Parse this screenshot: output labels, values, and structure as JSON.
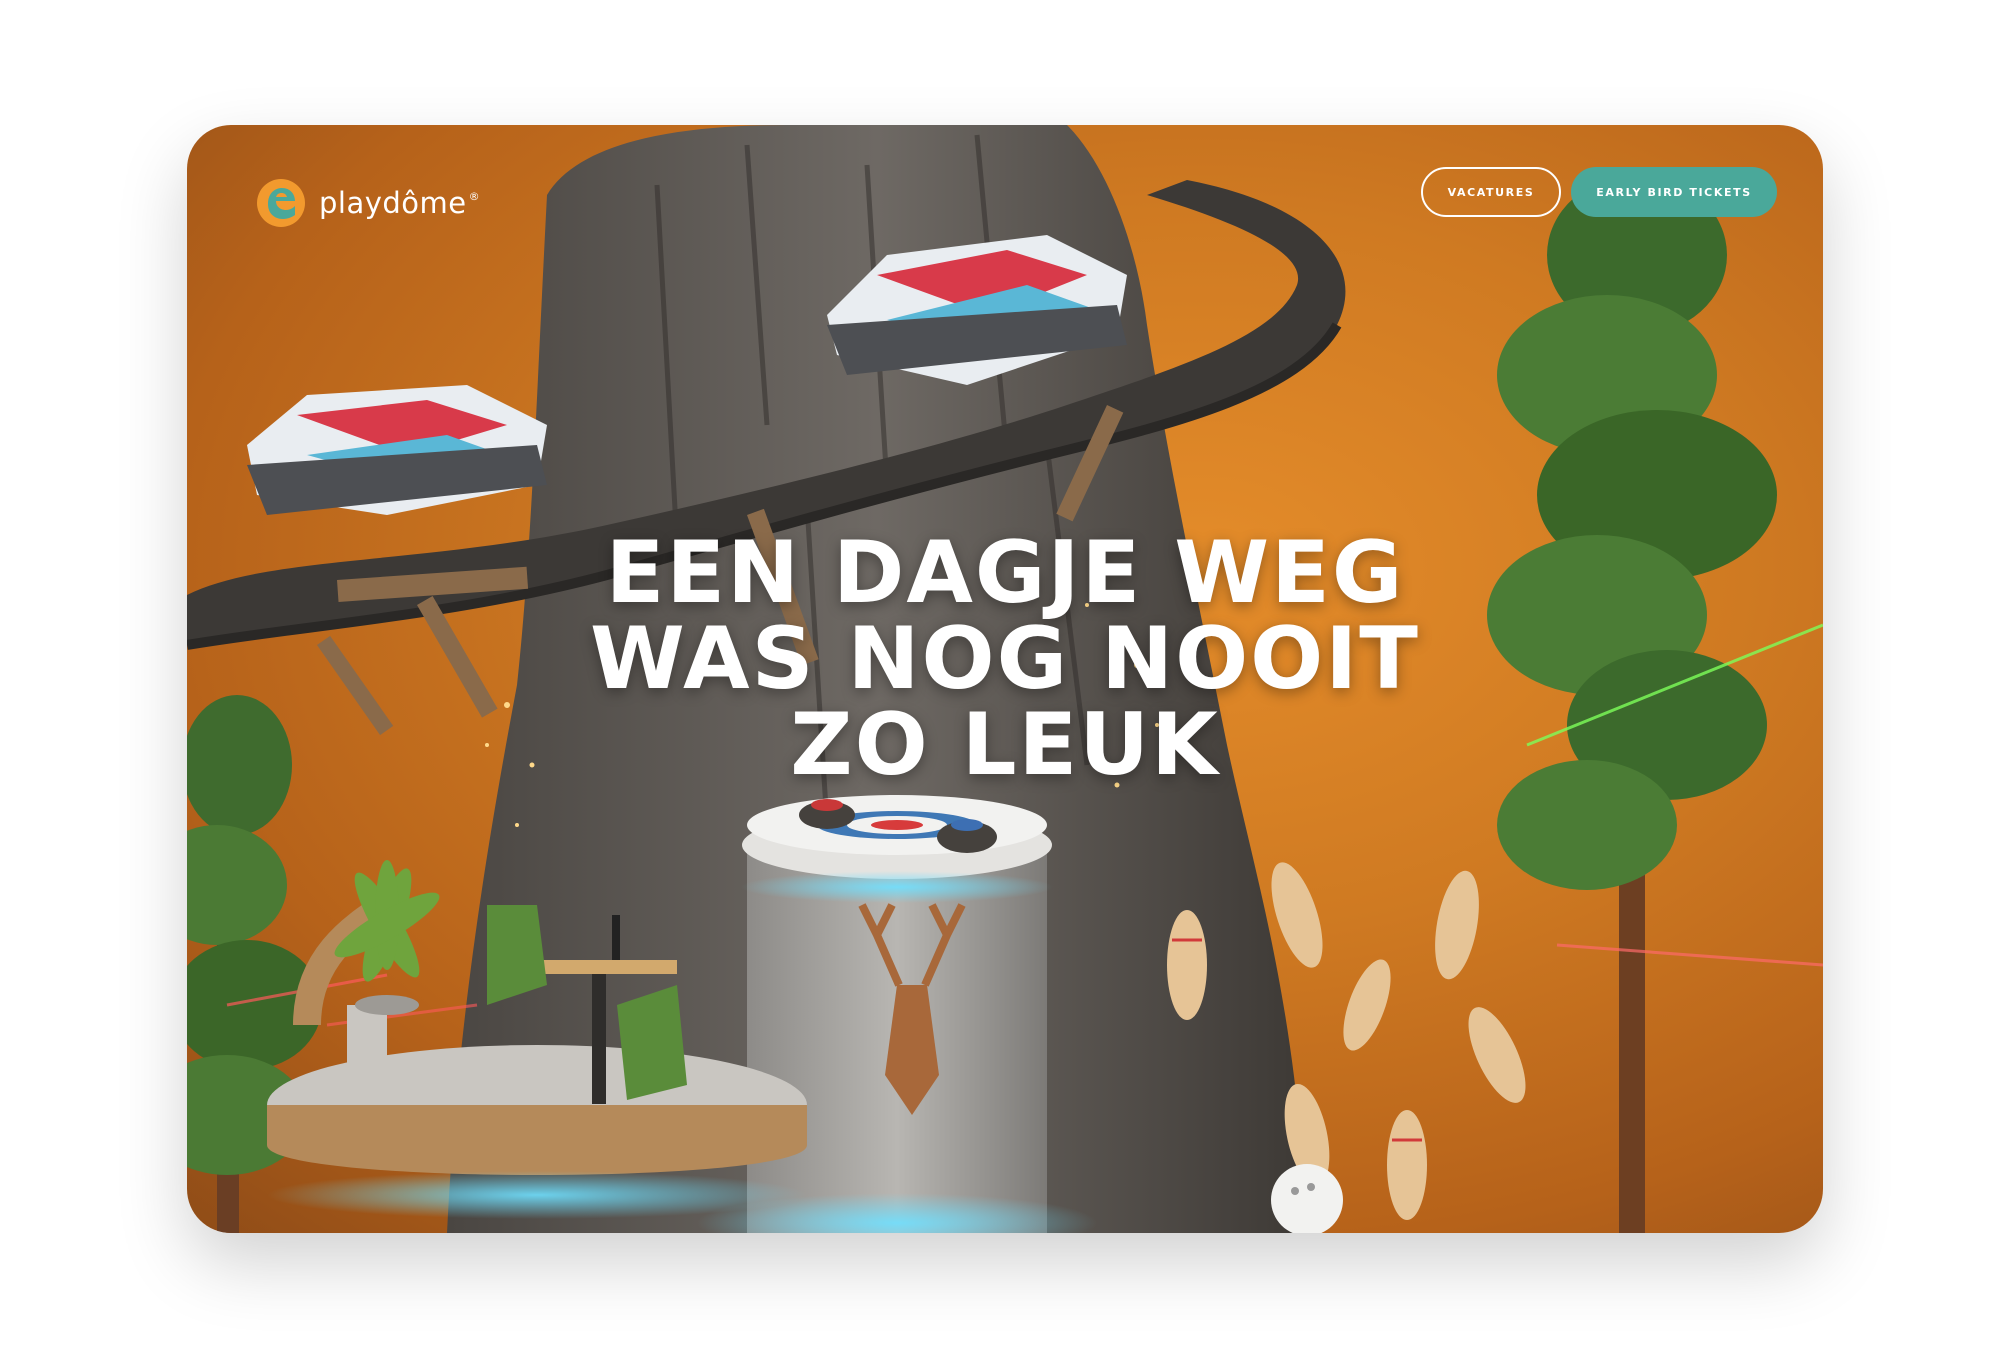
{
  "brand": {
    "name": "playdôme",
    "mark": "®",
    "colors": {
      "orange": "#f29a2e",
      "teal": "#4aa89a"
    }
  },
  "nav": {
    "vacatures_label": "VACATURES",
    "tickets_label": "EARLY BIRD TICKETS"
  },
  "hero": {
    "headline": [
      "EEN DAGJE WEG",
      "WAS NOG NOOIT",
      "ZO LEUK"
    ],
    "background_color": "#cf7a22"
  }
}
